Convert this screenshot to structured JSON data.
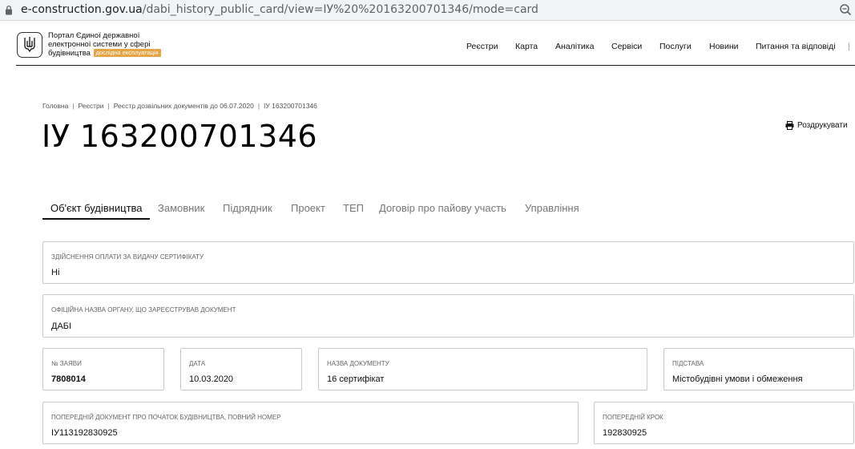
{
  "browser": {
    "url_domain": "e-construction.gov.ua",
    "url_path": "/dabi_history_public_card/view=ІУ%20%20163200701346/mode=card"
  },
  "header": {
    "portal_line1": "Портал Єдиної державної",
    "portal_line2": "електронної системи у сфері",
    "portal_line3": "будівництва",
    "badge": "дослідна експлуатація",
    "nav": [
      "Реєстри",
      "Карта",
      "Аналітика",
      "Сервіси",
      "Послуги",
      "Новини",
      "Питання та відповіді"
    ]
  },
  "breadcrumb": [
    "Головна",
    "Реєстри",
    "Реєстр дозвільних документів до 06.07.2020",
    "ІУ 163200701346"
  ],
  "page_title": "ІУ 163200701346",
  "print_label": "Роздрукувати",
  "tabs": [
    "Об'єкт будівництва",
    "Замовник",
    "Підрядник",
    "Проект",
    "ТЕП",
    "Договір про пайову участь",
    "Управління"
  ],
  "fields": {
    "payment": {
      "label": "Здійснення оплати за видачу сертифікату",
      "value": "Ні"
    },
    "organ": {
      "label": "Офіційна назва органу, що зареєстрував документ",
      "value": "ДАБІ"
    },
    "app_no": {
      "label": "№ заяви",
      "value": "7808014"
    },
    "date": {
      "label": "Дата",
      "value": "10.03.2020"
    },
    "doc_name": {
      "label": "Назва документу",
      "value": "16 сертифікат"
    },
    "basis": {
      "label": "Підстава",
      "value": "Містобудівні умови і обмеження"
    },
    "prev_doc": {
      "label": "Попередній документ про початок будівництва, повний номер",
      "value": "ІУ113192830925"
    },
    "prev_step": {
      "label": "Попередній крок",
      "value": "192830925"
    }
  },
  "colors": {
    "badge": "#e5a544",
    "border": "#c9c9c9"
  }
}
